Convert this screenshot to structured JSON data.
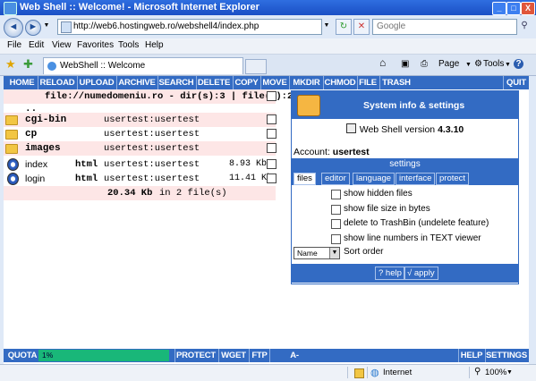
{
  "window": {
    "title": "Web Shell :: Welcome! - Microsoft Internet Explorer",
    "minimize": "_",
    "maximize": "□",
    "close": "X"
  },
  "address": {
    "url": "http://web6.hostingweb.ro/webshell4/index.php",
    "search_placeholder": "Google"
  },
  "menu": [
    "File",
    "Edit",
    "View",
    "Favorites",
    "Tools",
    "Help"
  ],
  "tabbar": {
    "tab_title": "WebShell :: Welcome",
    "page_label": "Page",
    "tools_label": "Tools",
    "help_label": "?"
  },
  "toolbar": {
    "buttons": [
      "HOME",
      "RELOAD",
      "UPLOAD",
      "ARCHIVE",
      "SEARCH",
      "DELETE",
      "COPY",
      "MOVE",
      "MKDIR",
      "CHMOD",
      "FILE",
      "TRASH"
    ],
    "quit": "QUIT"
  },
  "listing": {
    "header": "file://numedomeniu.ro - dir(s):3 | file(s):2",
    "parent": "..",
    "rows": [
      {
        "name": "cgi-bin",
        "kind": "dir",
        "type": "",
        "owner": "usertest:usertest",
        "size": ""
      },
      {
        "name": "cp",
        "kind": "dir",
        "type": "",
        "owner": "usertest:usertest",
        "size": ""
      },
      {
        "name": "images",
        "kind": "dir",
        "type": "",
        "owner": "usertest:usertest",
        "size": ""
      },
      {
        "name": "index",
        "kind": "file",
        "type": "html",
        "owner": "usertest:usertest",
        "size": "8.93 Kb"
      },
      {
        "name": "login",
        "kind": "file",
        "type": "html",
        "owner": "usertest:usertest",
        "size": "11.41 Kb"
      }
    ],
    "footer_size": "20.34 Kb",
    "footer_rest": "in 2 file(s)"
  },
  "sysinfo": {
    "title": "System info & settings",
    "version_prefix": "Web Shell version",
    "version": "4.3.10",
    "account_label": "Account:",
    "account": "usertest",
    "settings_label": "settings",
    "tabs": [
      "files",
      "editor",
      "language",
      "interface",
      "protect"
    ],
    "active_tab": "files",
    "options": [
      "show hidden files",
      "show file size in bytes",
      "delete to TrashBin (undelete feature)",
      "show line numbers in TEXT viewer"
    ],
    "sort_value": "Name",
    "sort_label": "Sort order",
    "help_btn": "? help",
    "apply_btn": "√ apply"
  },
  "bottom": {
    "quota_label": "QUOTA",
    "quota_percent": "1%",
    "quota_fraction": 0.01,
    "buttons": [
      "PROTECT",
      "WGET",
      "FTP",
      "A-COUNTER"
    ],
    "help": "HELP",
    "settings": "SETTINGS"
  },
  "status": {
    "zone": "Internet",
    "zoom": "100%"
  },
  "colors": {
    "accent": "#336bc3",
    "quota_fill": "#19b779",
    "pink_row": "#fde6e6"
  }
}
